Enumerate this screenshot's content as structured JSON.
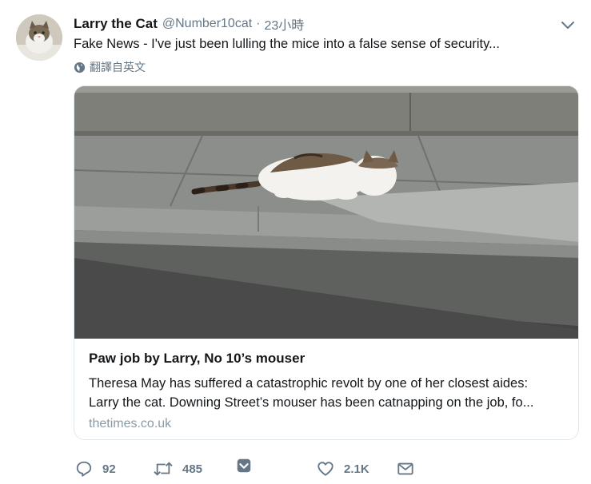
{
  "tweet": {
    "author_name": "Larry the Cat",
    "handle": "@Number10cat",
    "separator": "·",
    "time": "23小時",
    "text": "Fake News - I've just been lulling the mice into a false sense of security...",
    "translate_label": "翻譯自英文"
  },
  "card": {
    "title": "Paw job by Larry, No 10’s mouser",
    "description_line1": "Theresa May has suffered a catastrophic revolt by one of her closest aides:",
    "description_line2": "Larry the cat. Downing Street’s mouser has been catnapping on the job, fo...",
    "domain": "thetimes.co.uk"
  },
  "actions": {
    "reply_count": "92",
    "retweet_count": "485",
    "like_count": "2.1K"
  },
  "icons": {
    "menu": "chevron-down-icon",
    "translate": "globe-icon",
    "reply": "reply-icon",
    "retweet": "retweet-icon",
    "save": "save-icon",
    "like": "heart-icon",
    "message": "envelope-icon"
  },
  "colors": {
    "text": "#14171a",
    "secondary": "#657786",
    "border": "#e1e8ed"
  }
}
